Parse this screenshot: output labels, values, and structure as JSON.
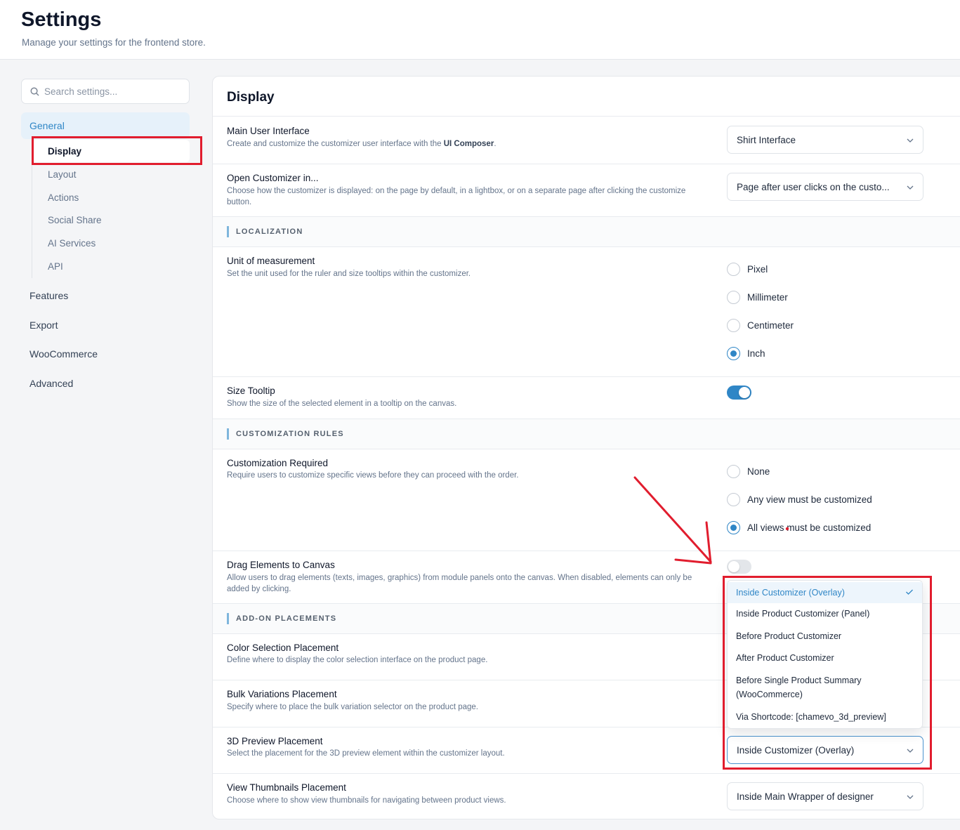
{
  "header": {
    "title": "Settings",
    "subtitle": "Manage your settings for the frontend store."
  },
  "sidebar": {
    "search_placeholder": "Search settings...",
    "general_label": "General",
    "subitems": [
      "Display",
      "Layout",
      "Actions",
      "Social Share",
      "AI Services",
      "API"
    ],
    "items": [
      "Features",
      "Export",
      "WooCommerce",
      "Advanced"
    ]
  },
  "panel": {
    "title": "Display",
    "main_ui": {
      "title": "Main User Interface",
      "desc_pre": "Create and customize the customizer user interface with the ",
      "desc_bold": "UI Composer",
      "desc_post": ".",
      "value": "Shirt Interface"
    },
    "open_customizer": {
      "title": "Open Customizer in...",
      "desc": "Choose how the customizer is displayed: on the page by default, in a lightbox, or on a separate page after clicking the customize button.",
      "value": "Page after user clicks on the custo..."
    },
    "localization_label": "LOCALIZATION",
    "unit": {
      "title": "Unit of measurement",
      "desc": "Set the unit used for the ruler and size tooltips within the customizer.",
      "options": [
        "Pixel",
        "Millimeter",
        "Centimeter",
        "Inch"
      ],
      "selected": "Inch"
    },
    "size_tooltip": {
      "title": "Size Tooltip",
      "desc": "Show the size of the selected element in a tooltip on the canvas.",
      "enabled": true
    },
    "rules_label": "CUSTOMIZATION RULES",
    "customization_required": {
      "title": "Customization Required",
      "desc": "Require users to customize specific views before they can proceed with the order.",
      "options": [
        "None",
        "Any view must be customized",
        "All views must be customized"
      ],
      "selected": "All views must be customized"
    },
    "drag_elements": {
      "title": "Drag Elements to Canvas",
      "desc": "Allow users to drag elements (texts, images, graphics) from module panels onto the canvas. When disabled, elements can only be added by clicking.",
      "enabled": false
    },
    "addon_label": "ADD-ON PLACEMENTS",
    "color_selection": {
      "title": "Color Selection Placement",
      "desc": "Define where to display the color selection interface on the product page."
    },
    "bulk_variations": {
      "title": "Bulk Variations Placement",
      "desc": "Specify where to place the bulk variation selector on the product page."
    },
    "preview_3d": {
      "title": "3D Preview Placement",
      "desc": "Select the placement for the 3D preview element within the customizer layout.",
      "value": "Inside Customizer (Overlay)"
    },
    "view_thumbnails": {
      "title": "View Thumbnails Placement",
      "desc": "Choose where to show view thumbnails for navigating between product views.",
      "value": "Inside Main Wrapper of designer"
    }
  },
  "dropdown": {
    "options": [
      "Inside Customizer (Overlay)",
      "Inside Product Customizer (Panel)",
      "Before Product Customizer",
      "After Product Customizer",
      "Before Single Product Summary (WooCommerce)",
      "Via Shortcode: [chamevo_3d_preview]"
    ],
    "selected": "Inside Customizer (Overlay)"
  },
  "colors": {
    "accent": "#2f86c6",
    "annotation": "#e11d2e"
  },
  "icons": [
    "search-icon",
    "chevron-down-icon",
    "check-icon"
  ]
}
